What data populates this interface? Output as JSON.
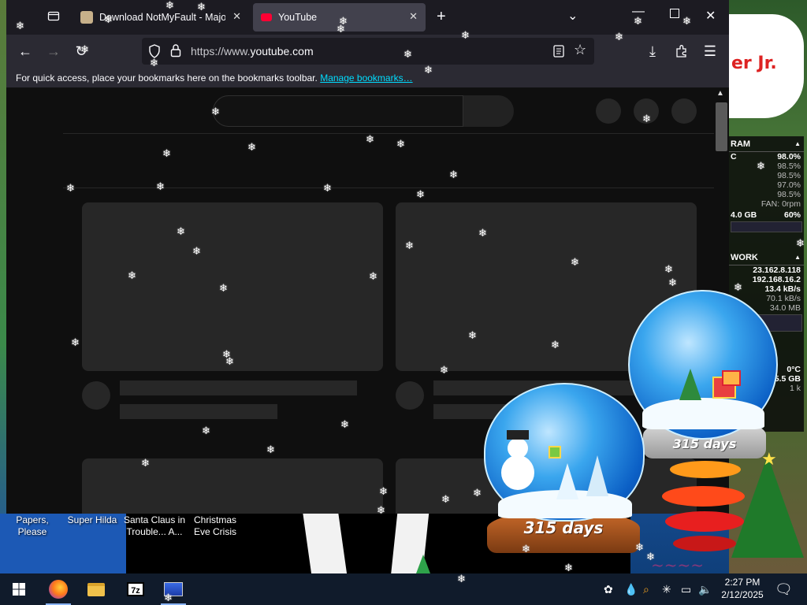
{
  "browser": {
    "tabs": [
      {
        "title": "Download NotMyFault - MajorG",
        "active": false
      },
      {
        "title": "YouTube",
        "active": true
      }
    ],
    "url": {
      "prefix": "https://www.",
      "domain": "youtube.com"
    },
    "bookmarks_bar": {
      "message": "For quick access, place your bookmarks here on the bookmarks toolbar.",
      "link": "Manage bookmarks…"
    }
  },
  "desktop": {
    "bubble_text": "er Jr.",
    "icons": [
      "Papers, Please",
      "Super Hilda",
      "Santa Claus in Trouble... A...",
      "Christmas Eve Crisis"
    ]
  },
  "gadget": {
    "ram": {
      "header": "RAM",
      "c_label": "C",
      "c_value": "98.0%",
      "lines": [
        "98.5%",
        "98.5%",
        "97.0%",
        "98.5%"
      ],
      "fan": "FAN: 0rpm",
      "mem": "4.0 GB",
      "mem_pct": "60%"
    },
    "network": {
      "header": "WORK",
      "ip1": "23.162.8.118",
      "ip2": "192.168.16.2",
      "up": "13.4 kB/s",
      "down": "70.1 kB/s",
      "total": "34.0 MB"
    },
    "misc": {
      "temp": "0°C",
      "disk": "5.5 GB",
      "k": "1 k"
    }
  },
  "globes": {
    "large_days": "315 days",
    "small_days": "315 days"
  },
  "taskbar": {
    "time": "2:27 PM",
    "date": "2/12/2025",
    "apps": [
      "start",
      "firefox",
      "file-explorer",
      "7zip",
      "window"
    ]
  },
  "colors": {
    "accent_link": "#00ddff",
    "taskbar": "#101b2b",
    "tab_active": "#42414d"
  }
}
